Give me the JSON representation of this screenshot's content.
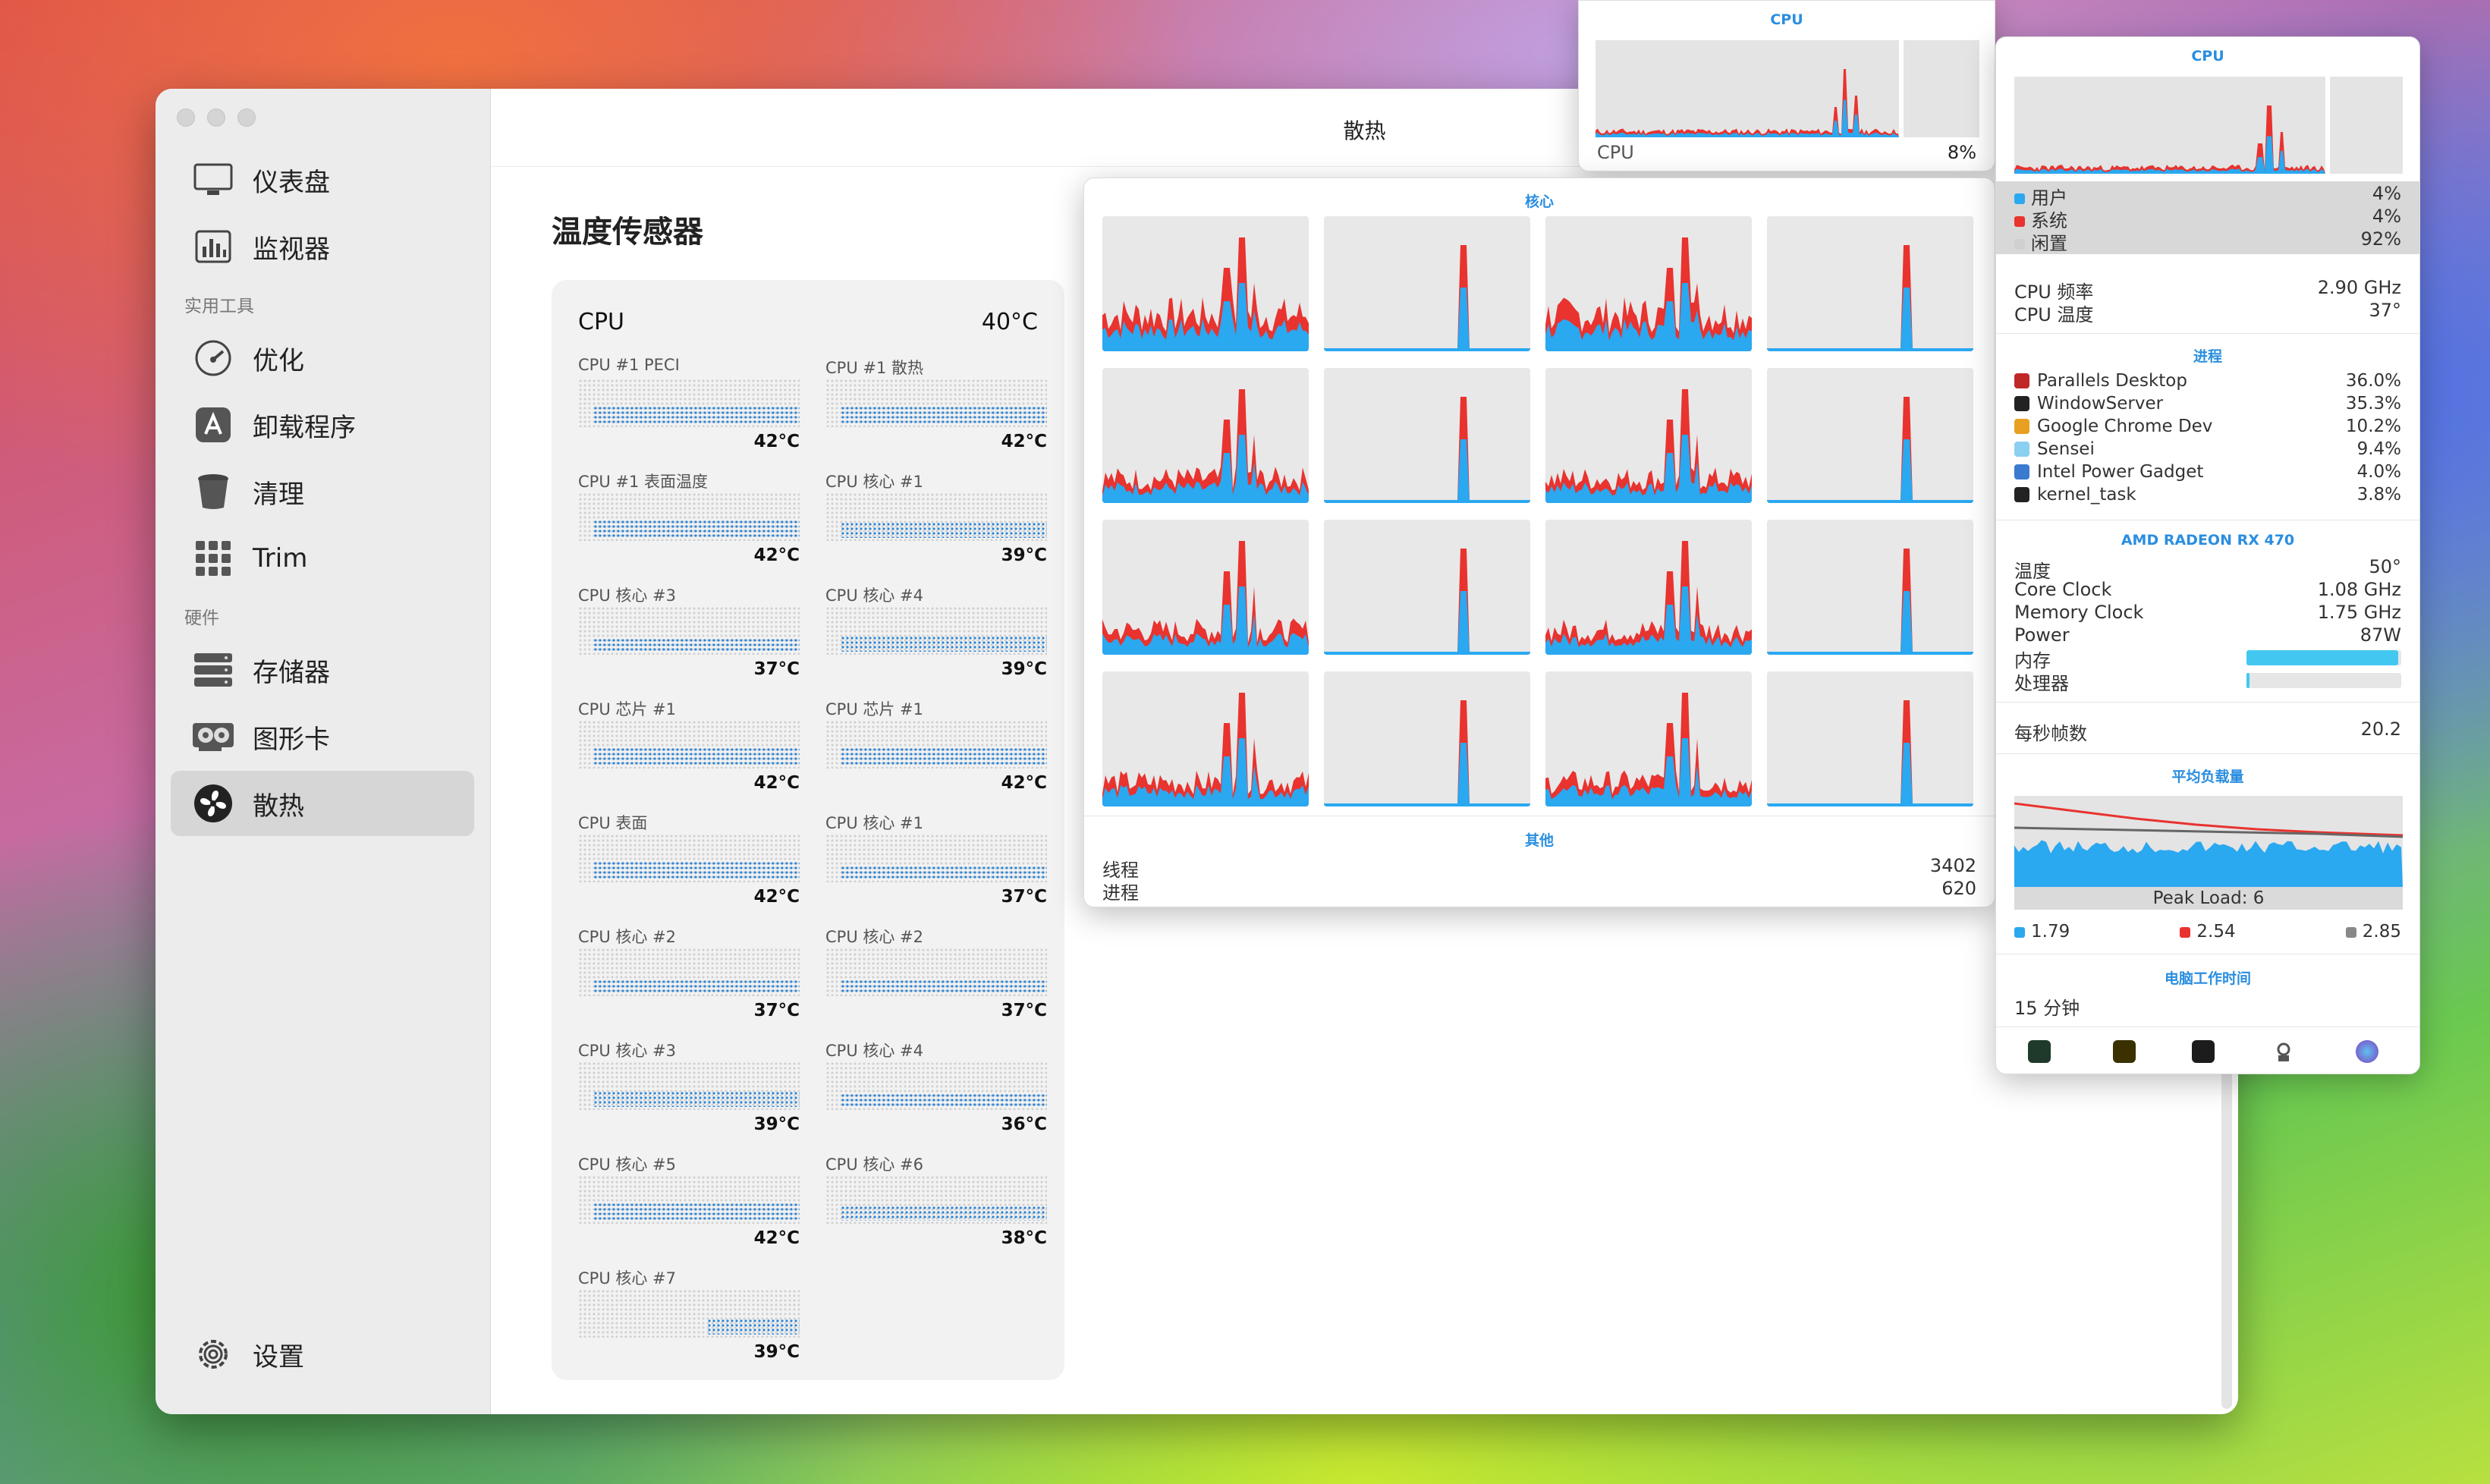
{
  "app": {
    "window_title": "散热",
    "sidebar": {
      "items": [
        {
          "label": "仪表盘",
          "icon": "monitor-icon"
        },
        {
          "label": "监视器",
          "icon": "chart-icon"
        },
        {
          "label": "优化",
          "icon": "gauge-icon"
        },
        {
          "label": "卸载程序",
          "icon": "app-store-icon"
        },
        {
          "label": "清理",
          "icon": "trash-icon"
        },
        {
          "label": "Trim",
          "icon": "grid-icon"
        },
        {
          "label": "存储器",
          "icon": "drive-icon"
        },
        {
          "label": "图形卡",
          "icon": "gpu-icon"
        },
        {
          "label": "散热",
          "icon": "fan-icon",
          "selected": true
        }
      ],
      "section_tools": "实用工具",
      "section_hardware": "硬件",
      "settings": "设置"
    },
    "page_heading": "温度传感器",
    "cpu_card": {
      "title": "CPU",
      "value": "40°C",
      "sensors": [
        {
          "label": "CPU #1 PECI",
          "value": "42°C",
          "level": 0.4
        },
        {
          "label": "CPU #1 散热",
          "value": "42°C",
          "level": 0.4
        },
        {
          "label": "CPU #1 表面温度",
          "value": "42°C",
          "level": 0.4
        },
        {
          "label": "CPU 核心 #1",
          "value": "39°C",
          "level": 0.35
        },
        {
          "label": "CPU 核心 #3",
          "value": "37°C",
          "level": 0.3
        },
        {
          "label": "CPU 核心 #4",
          "value": "39°C",
          "level": 0.35
        },
        {
          "label": "CPU 芯片 #1",
          "value": "42°C",
          "level": 0.4
        },
        {
          "label": "CPU 芯片 #1",
          "value": "42°C",
          "level": 0.4
        },
        {
          "label": "CPU 表面",
          "value": "42°C",
          "level": 0.4
        },
        {
          "label": "CPU 核心 #1",
          "value": "37°C",
          "level": 0.3
        },
        {
          "label": "CPU 核心 #2",
          "value": "37°C",
          "level": 0.3
        },
        {
          "label": "CPU 核心 #2",
          "value": "37°C",
          "level": 0.3
        },
        {
          "label": "CPU 核心 #3",
          "value": "39°C",
          "level": 0.35
        },
        {
          "label": "CPU 核心 #4",
          "value": "36°C",
          "level": 0.3
        },
        {
          "label": "CPU 核心 #5",
          "value": "42°C",
          "level": 0.4
        },
        {
          "label": "CPU 核心 #6",
          "value": "38°C",
          "level": 0.33
        },
        {
          "label": "CPU 核心 #7",
          "value": "39°C",
          "level": 0.35
        }
      ]
    }
  },
  "cpu_mini": {
    "title": "CPU",
    "label": "CPU",
    "value": "8%"
  },
  "cores_popup": {
    "title": "核心",
    "other_title": "其他",
    "threads_label": "线程",
    "threads_value": "3402",
    "processes_label": "进程",
    "processes_value": "620"
  },
  "stats_popup": {
    "title": "CPU",
    "legend": [
      {
        "label": "用户",
        "value": "4%",
        "color": "#2aa8f0"
      },
      {
        "label": "系统",
        "value": "4%",
        "color": "#e8332f"
      },
      {
        "label": "闲置",
        "value": "92%",
        "color": "#d0d0d0"
      }
    ],
    "freq_label": "CPU 频率",
    "freq_value": "2.90 GHz",
    "temp_label": "CPU 温度",
    "temp_value": "37°",
    "processes_title": "进程",
    "processes": [
      {
        "name": "Parallels Desktop",
        "value": "36.0%",
        "icon": "parallels-icon"
      },
      {
        "name": "WindowServer",
        "value": "35.3%",
        "icon": "windowserver-icon"
      },
      {
        "name": "Google Chrome Dev",
        "value": "10.2%",
        "icon": "chrome-icon"
      },
      {
        "name": "Sensei",
        "value": "9.4%",
        "icon": "sensei-icon"
      },
      {
        "name": "Intel Power Gadget",
        "value": "4.0%",
        "icon": "power-gadget-icon"
      },
      {
        "name": "kernel_task",
        "value": "3.8%",
        "icon": "kernel-icon"
      }
    ],
    "gpu_title": "AMD RADEON RX 470",
    "gpu": [
      {
        "label": "温度",
        "value": "50°"
      },
      {
        "label": "Core Clock",
        "value": "1.08 GHz"
      },
      {
        "label": "Memory Clock",
        "value": "1.75 GHz"
      },
      {
        "label": "Power",
        "value": "87W"
      }
    ],
    "mem_label": "内存",
    "mem_level": 0.98,
    "proc_label": "处理器",
    "proc_level": 0.02,
    "fps_label": "每秒帧数",
    "fps_value": "20.2",
    "load_title": "平均负载量",
    "peak_load": "Peak Load: 6",
    "loads": [
      {
        "value": "1.79",
        "color": "#2aa8f0"
      },
      {
        "value": "2.54",
        "color": "#e8332f"
      },
      {
        "value": "2.85",
        "color": "#888888"
      }
    ],
    "uptime_title": "电脑工作时间",
    "uptime_value": "15 分钟"
  }
}
